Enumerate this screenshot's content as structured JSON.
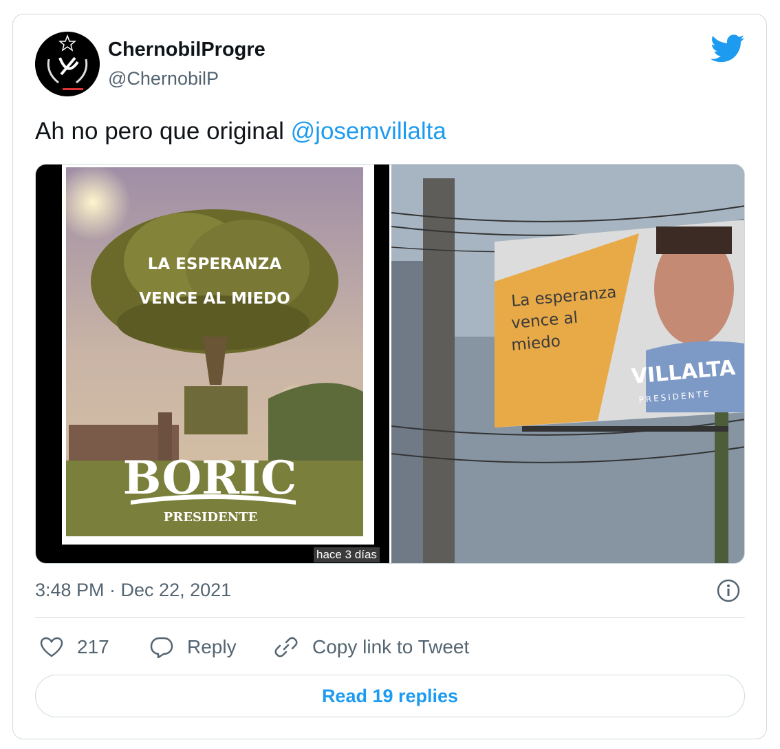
{
  "tweet": {
    "author_name": "ChernobilProgre",
    "author_handle": "@ChernobilP",
    "text_prefix": "Ah no pero que original ",
    "mention": "@josemvillalta",
    "timestamp": "3:48 PM · Dec 22, 2021"
  },
  "media": {
    "left_poster": {
      "headline_line1": "LA ESPERANZA",
      "headline_line2": "VENCE AL MIEDO",
      "brand": "BORIC",
      "subtitle": "PRESIDENTE",
      "caption_chip": "hace 3 días"
    },
    "right_billboard": {
      "line1": "La esperanza",
      "line2": "vence al",
      "line3": "miedo",
      "brand": "VILLALTA",
      "subtitle": "PRESIDENTE"
    }
  },
  "actions": {
    "likes_count": "217",
    "reply_label": "Reply",
    "copy_link_label": "Copy link to Tweet",
    "read_replies_label": "Read 19 replies"
  },
  "colors": {
    "accent": "#1d9bf0",
    "muted": "#536471",
    "border": "#cfd9de"
  },
  "icons": [
    "twitter-bird-icon",
    "info-icon",
    "heart-icon",
    "reply-bubble-icon",
    "link-icon"
  ]
}
